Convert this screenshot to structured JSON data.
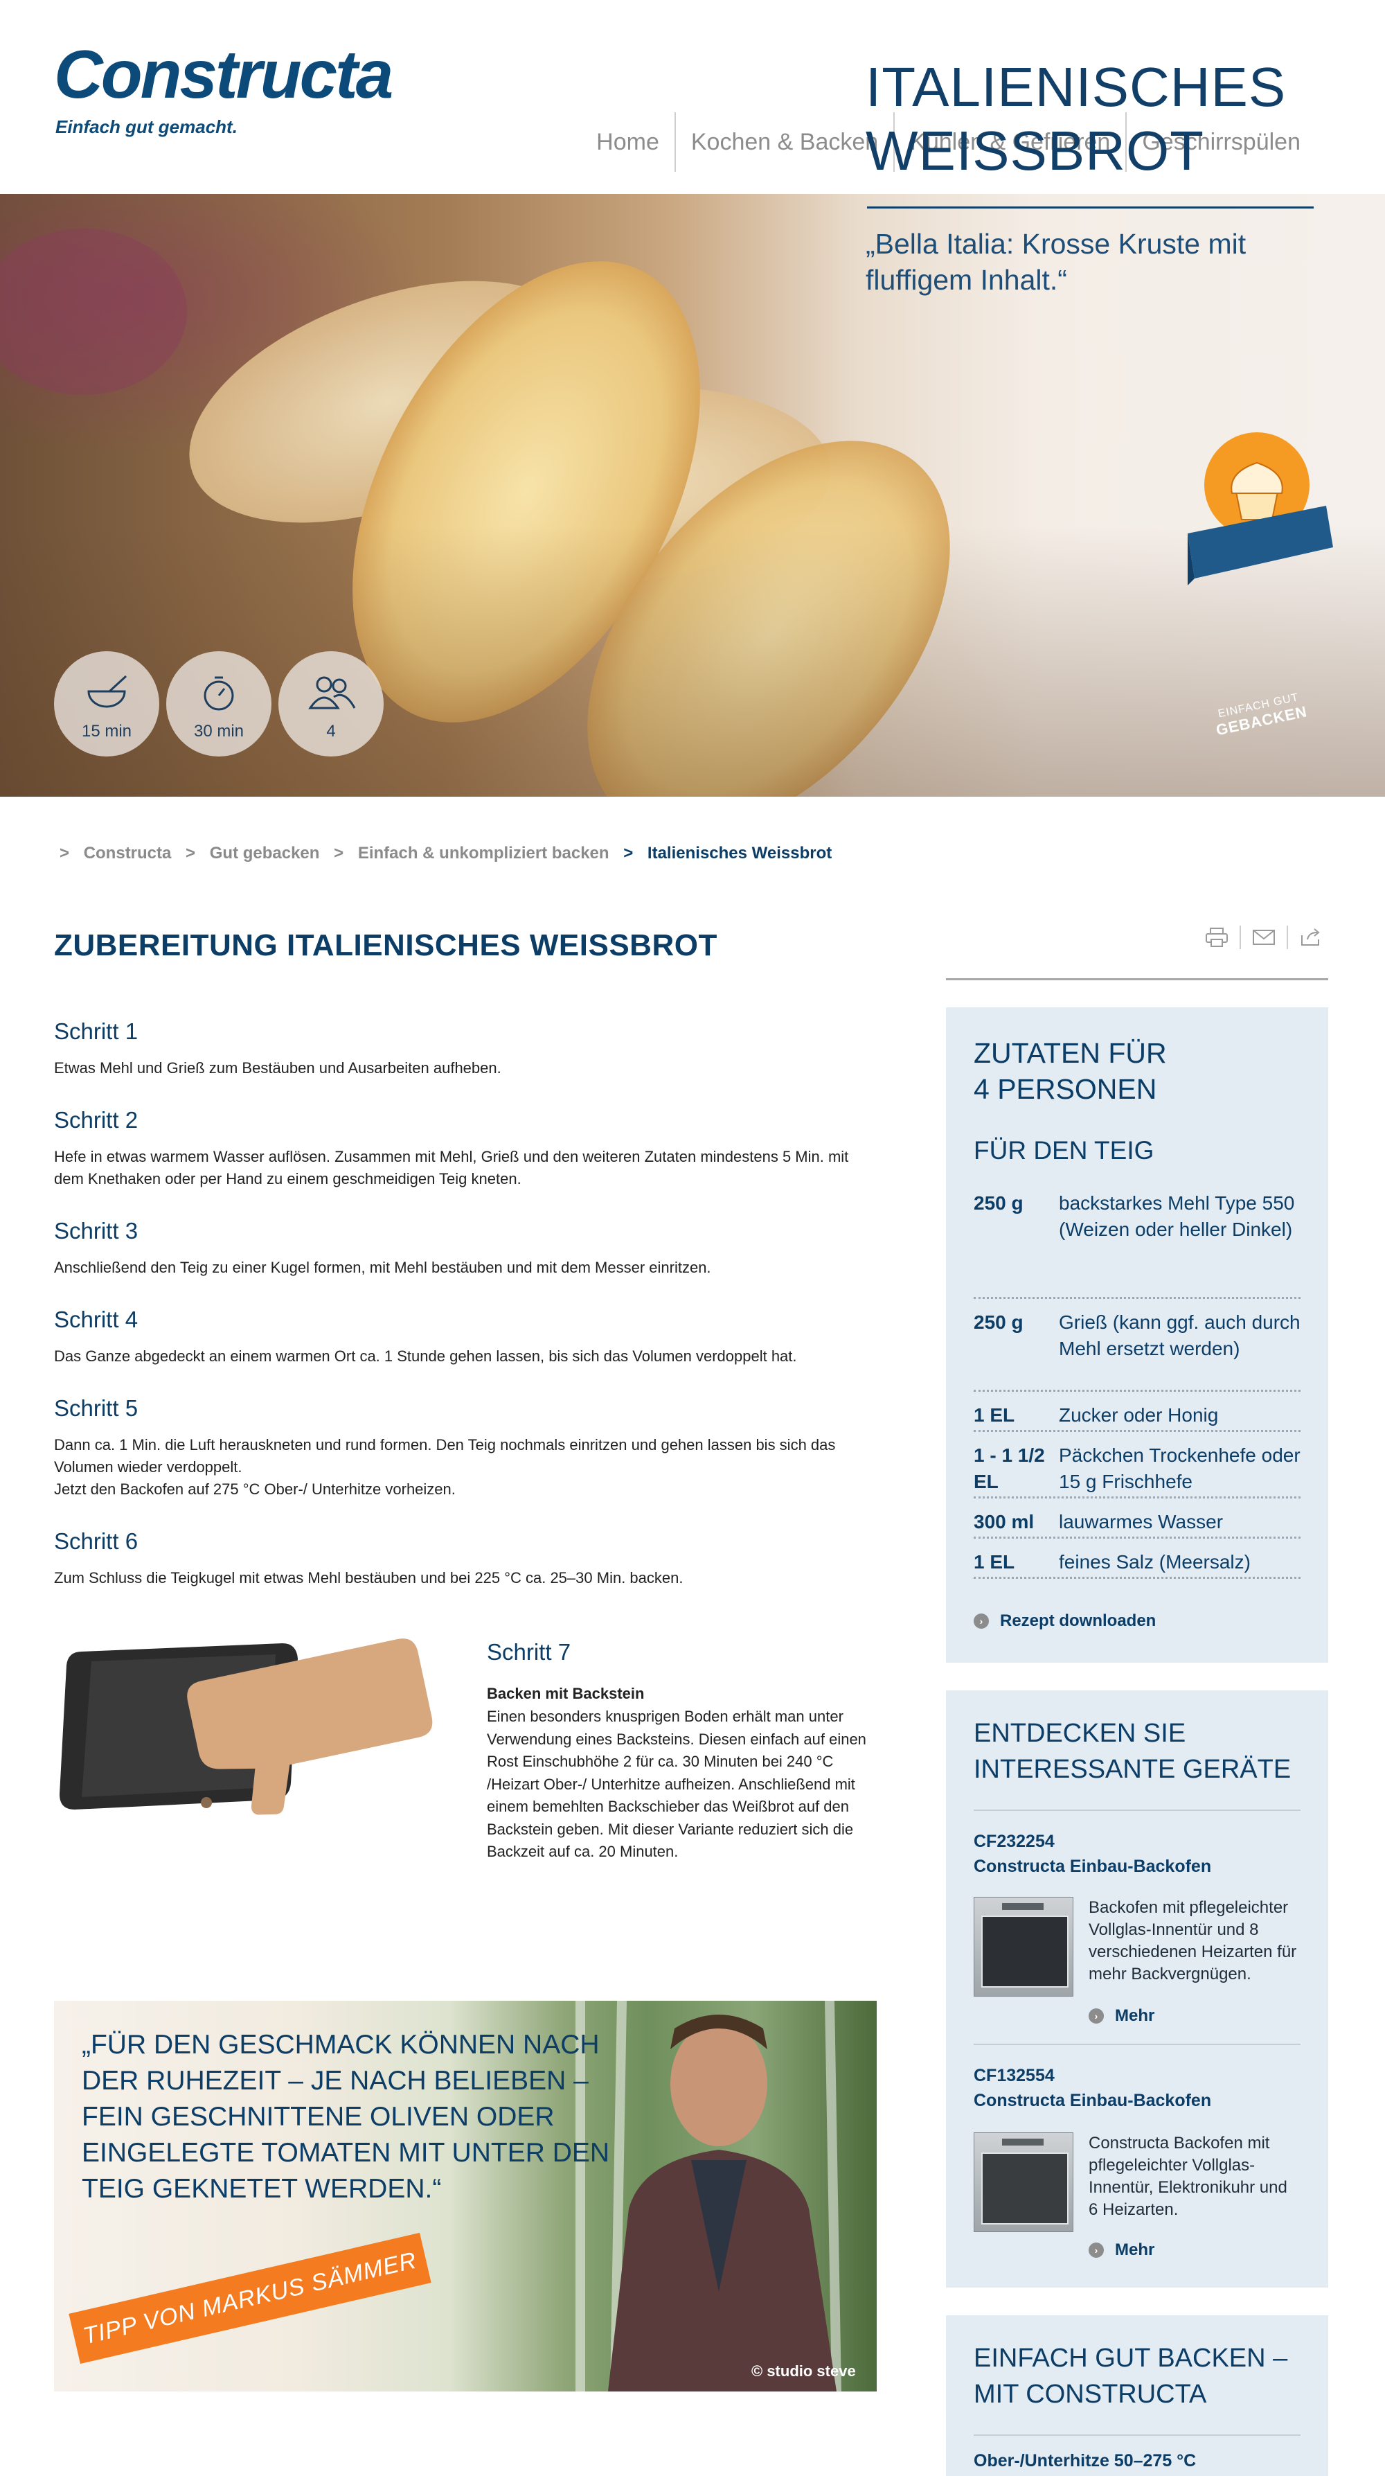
{
  "header": {
    "logo": "Constructa",
    "tagline": "Einfach gut gemacht.",
    "nav": [
      "Home",
      "Kochen & Backen",
      "Kühlen & Gefrieren",
      "Geschirrspülen"
    ]
  },
  "hero": {
    "title_line1": "ITALIENISCHES",
    "title_line2": "WEISSBROT",
    "subtitle": "„Bella Italia: Krosse Kruste mit fluffigem Inhalt.“",
    "stats": [
      {
        "icon": "bowl-whisk-icon",
        "label": "15 min"
      },
      {
        "icon": "stopwatch-icon",
        "label": "30 min"
      },
      {
        "icon": "people-icon",
        "label": "4"
      }
    ],
    "badge_line1": "EINFACH GUT",
    "badge_line2": "GEBACKEN",
    "badge_icon": "cupcake-icon"
  },
  "breadcrumb": {
    "separator": ">",
    "items": [
      "Constructa",
      "Gut gebacken",
      "Einfach & unkompliziert backen",
      "Italienisches Weissbrot"
    ]
  },
  "main": {
    "title": "ZUBEREITUNG ITALIENISCHES WEISSBROT",
    "steps": [
      {
        "title": "Schritt 1",
        "text": "Etwas Mehl und Grieß zum Bestäuben und Ausarbeiten aufheben."
      },
      {
        "title": "Schritt 2",
        "text": "Hefe in etwas warmem Wasser auflösen. Zusammen mit Mehl, Grieß und den weiteren Zutaten mindestens 5 Min. mit dem Knethaken oder per Hand zu einem geschmeidigen Teig kneten."
      },
      {
        "title": "Schritt 3",
        "text": "Anschließend den Teig zu einer Kugel formen, mit Mehl bestäuben und mit dem Messer einritzen."
      },
      {
        "title": "Schritt 4",
        "text": "Das Ganze abgedeckt an einem warmen Ort ca. 1 Stunde gehen lassen, bis sich das Volumen verdoppelt hat."
      },
      {
        "title": "Schritt 5",
        "text": "Dann ca. 1 Min. die Luft herauskneten und rund formen. Den Teig nochmals einritzen und gehen lassen bis sich das Volumen wieder verdoppelt.",
        "text2": "Jetzt den Backofen auf 275 °C Ober-/ Unterhitze vorheizen."
      },
      {
        "title": "Schritt 6",
        "text": "Zum Schluss die Teigkugel mit etwas Mehl bestäuben und bei 225 °C ca. 25–30 Min. backen."
      }
    ],
    "step7": {
      "title": "Schritt 7",
      "subtitle": "Backen mit Backstein",
      "text": "Einen besonders knusprigen Boden erhält man unter Verwendung eines Backsteins. Diesen einfach auf einen Rost Einschubhöhe 2 für ca. 30 Minuten bei 240 °C /Heizart Ober-/ Unterhitze aufheizen. Anschließend mit einem bemehlten Backschieber das Weißbrot auf den Backstein geben. Mit dieser Variante reduziert sich die Backzeit auf ca. 20 Minuten."
    },
    "quote": {
      "text": "„FÜR DEN GESCHMACK KÖNNEN NACH DER RUHEZEIT – JE NACH BELIEBEN – FEIN GESCHNITTENE OLIVEN ODER EINGELEGTE TOMATEN MIT UNTER DEN TEIG GEKNETET WERDEN.“",
      "banner": "TIPP VON MARKUS SÄMMER",
      "credit": "© studio steve"
    }
  },
  "sidebar": {
    "share_icons": [
      "print-icon",
      "mail-icon",
      "share-icon"
    ],
    "ingredients": {
      "title_line1": "ZUTATEN FÜR",
      "title_line2": "4 PERSONEN",
      "section": "FÜR DEN TEIG",
      "items": [
        {
          "qty": "250 g",
          "text": "backstarkes Mehl Type 550 (Weizen oder heller Dinkel)"
        },
        {
          "qty": "250 g",
          "text": "Grieß (kann ggf. auch durch Mehl ersetzt werden)"
        },
        {
          "qty": "1 EL",
          "text": "Zucker oder Honig"
        },
        {
          "qty": "1 - 1 1/2 EL",
          "text": "Päckchen Trockenhefe oder 15 g Frischhefe"
        },
        {
          "qty": "300 ml",
          "text": "lauwarmes Wasser"
        },
        {
          "qty": "1 EL",
          "text": "feines Salz (Meersalz)"
        }
      ],
      "download": "Rezept downloaden"
    },
    "devices": {
      "title_line1": "ENTDECKEN SIE",
      "title_line2": "INTERESSANTE GERÄTE",
      "items": [
        {
          "id": "CF232254",
          "name": "Constructa Einbau-Backofen",
          "desc": "Backofen mit pflegeleichter Vollglas-Innentür und 8 verschiedenen Heizarten für mehr Backvergnügen.",
          "more": "Mehr"
        },
        {
          "id": "CF132554",
          "name": "Constructa Einbau-Backofen",
          "desc": "Constructa Backofen mit pflegeleichter Vollglas-Innentür, Elektronikuhr und 6 Heizarten.",
          "more": "Mehr"
        }
      ]
    },
    "baking": {
      "title_line1": "EINFACH GUT BACKEN –",
      "title_line2": "MIT CONSTRUCTA",
      "info": "Ober-/Unterhitze 50–275 °C"
    }
  }
}
